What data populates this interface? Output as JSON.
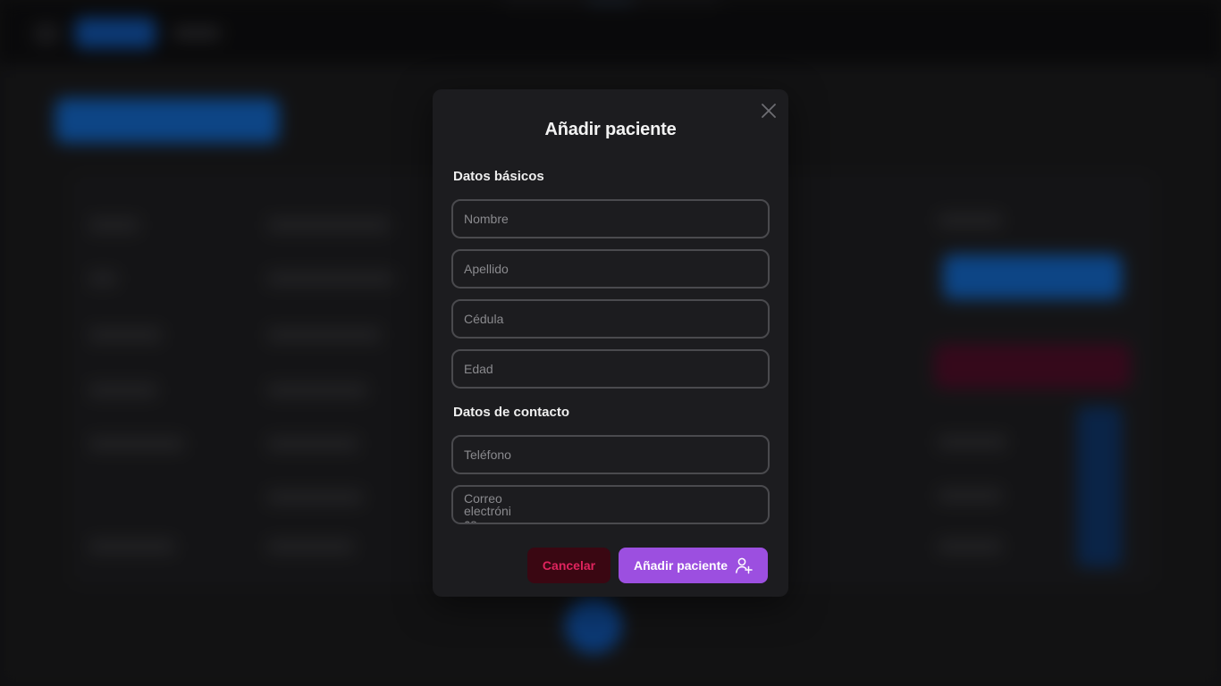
{
  "modal": {
    "title": "Añadir paciente",
    "sections": {
      "basic": "Datos básicos",
      "contact": "Datos de contacto"
    },
    "fields": {
      "first_name_placeholder": "Nombre",
      "last_name_placeholder": "Apellido",
      "id_number_placeholder": "Cédula",
      "age_placeholder": "Edad",
      "phone_placeholder": "Teléfono",
      "email_placeholder": "Correo electrónico"
    },
    "buttons": {
      "cancel_label": "Cancelar",
      "add_label": "Añadir paciente"
    },
    "icons": {
      "close": "close-icon",
      "add_user": "user-plus-icon"
    }
  },
  "colors": {
    "primary": "#9c4fe0",
    "danger_text": "#e0245e",
    "danger_bg": "#3a0712",
    "modal_bg": "#1c1c1f"
  }
}
